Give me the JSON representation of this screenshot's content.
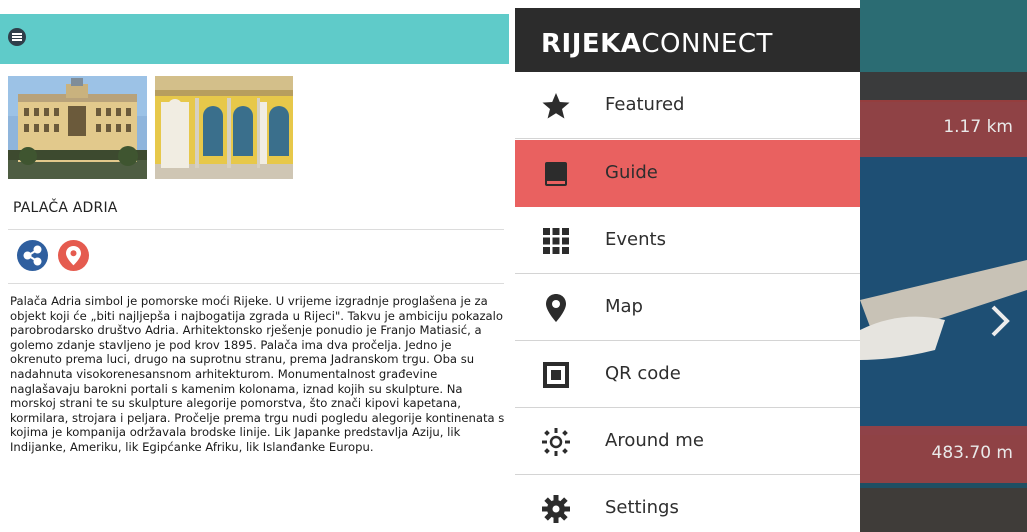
{
  "detail": {
    "title": "PALAČA ADRIA",
    "description": "Palača Adria simbol je pomorske moći Rijeke. U vrijeme izgradnje proglašena je za objekt koji će „biti najljepša i najbogatija zgrada u Rijeci\". Takvu je ambiciju pokazalo parobrodarsko društvo Adria. Arhitektonsko rješenje ponudio je Franjo Matiasić, a golemo zdanje stavljeno je pod krov 1895. Palača ima dva pročelja. Jedno je okrenuto prema luci, drugo na suprotnu stranu, prema Jadranskom trgu. Oba su nadahnuta visokorenesansnom arhitekturom. Monumentalnost građevine naglašavaju barokni portali s kamenim kolonama, iznad kojih su skulpture. Na morskoj strani te su skulpture alegorije pomorstva, što znači kipovi kapetana, kormilara, strojara i peljara. Pročelje prema trgu nudi pogledu alegorije kontinenata s kojima je kompanija održavala brodske linije. Lik Japanke predstavlja Aziju, lik Indijanke, Ameriku, lik Egipćanke Afriku, lik Islanđanke Europu.",
    "menu_icon": "hamburger-icon",
    "share_icon": "share-icon",
    "location_icon": "map-pin-icon"
  },
  "drawer": {
    "brand_bold": "RIJEKA",
    "brand_light": "CONNECT",
    "items": [
      {
        "label": "Featured",
        "icon": "star-icon"
      },
      {
        "label": "Guide",
        "icon": "book-icon",
        "active": true
      },
      {
        "label": "Events",
        "icon": "grid-icon"
      },
      {
        "label": "Map",
        "icon": "map-pin-icon"
      },
      {
        "label": "QR code",
        "icon": "qr-code-icon"
      },
      {
        "label": "Around me",
        "icon": "radar-icon"
      },
      {
        "label": "Settings",
        "icon": "gear-icon"
      }
    ]
  },
  "background": {
    "distances": [
      "1.17 km",
      "483.70 m"
    ],
    "next_icon": "chevron-right-icon"
  },
  "colors": {
    "header_teal": "#5fcbc9",
    "drawer_dark": "#2c2c2c",
    "active_red": "#e96160",
    "share_blue": "#2f5f9f",
    "pin_red": "#e55b4f"
  }
}
